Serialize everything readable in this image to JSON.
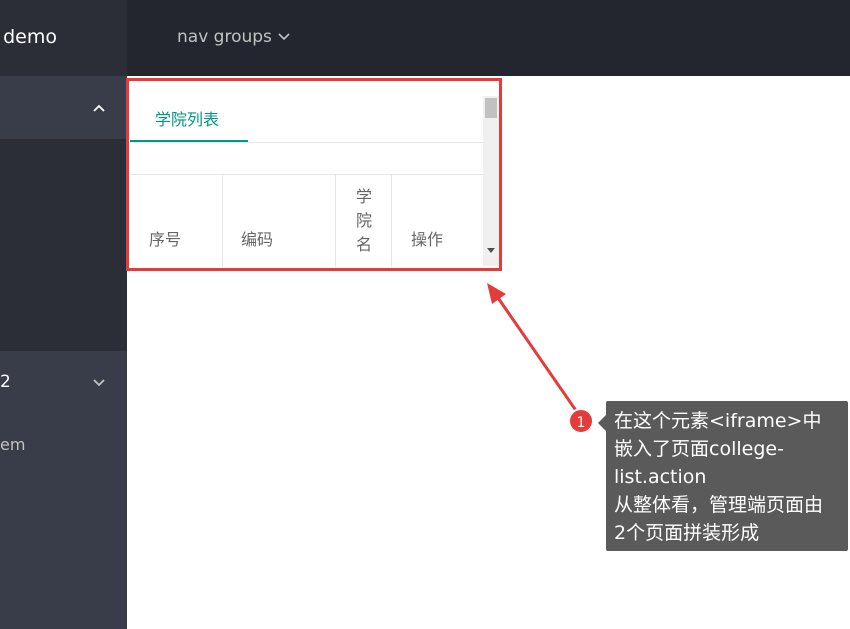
{
  "header": {
    "logo_text": "t demo",
    "nav_groups_label": "nav groups",
    "nav_groups_icon": "chevron-down-icon"
  },
  "sidebar": {
    "group1_icon": "chevron-up-icon",
    "group2_label": "2",
    "group2_icon": "chevron-down-icon",
    "sub_item_label": "em"
  },
  "iframe": {
    "tab_title": "学院列表",
    "columns": [
      "序号",
      "编码",
      "学院名称",
      "操作"
    ],
    "column_visible": [
      "序号",
      "编码",
      "学院名",
      "操作"
    ]
  },
  "annotation": {
    "badge_number": "1",
    "tooltip_lines": [
      "在这个元素<iframe>中",
      "嵌入了页面college-",
      "list.action",
      "从整体看，管理端页面由",
      "2个页面拼装形成"
    ]
  },
  "colors": {
    "header_bg": "#23262e",
    "sidebar_bg": "#393d49",
    "accent": "#009688",
    "highlight": "#e43b3b"
  }
}
